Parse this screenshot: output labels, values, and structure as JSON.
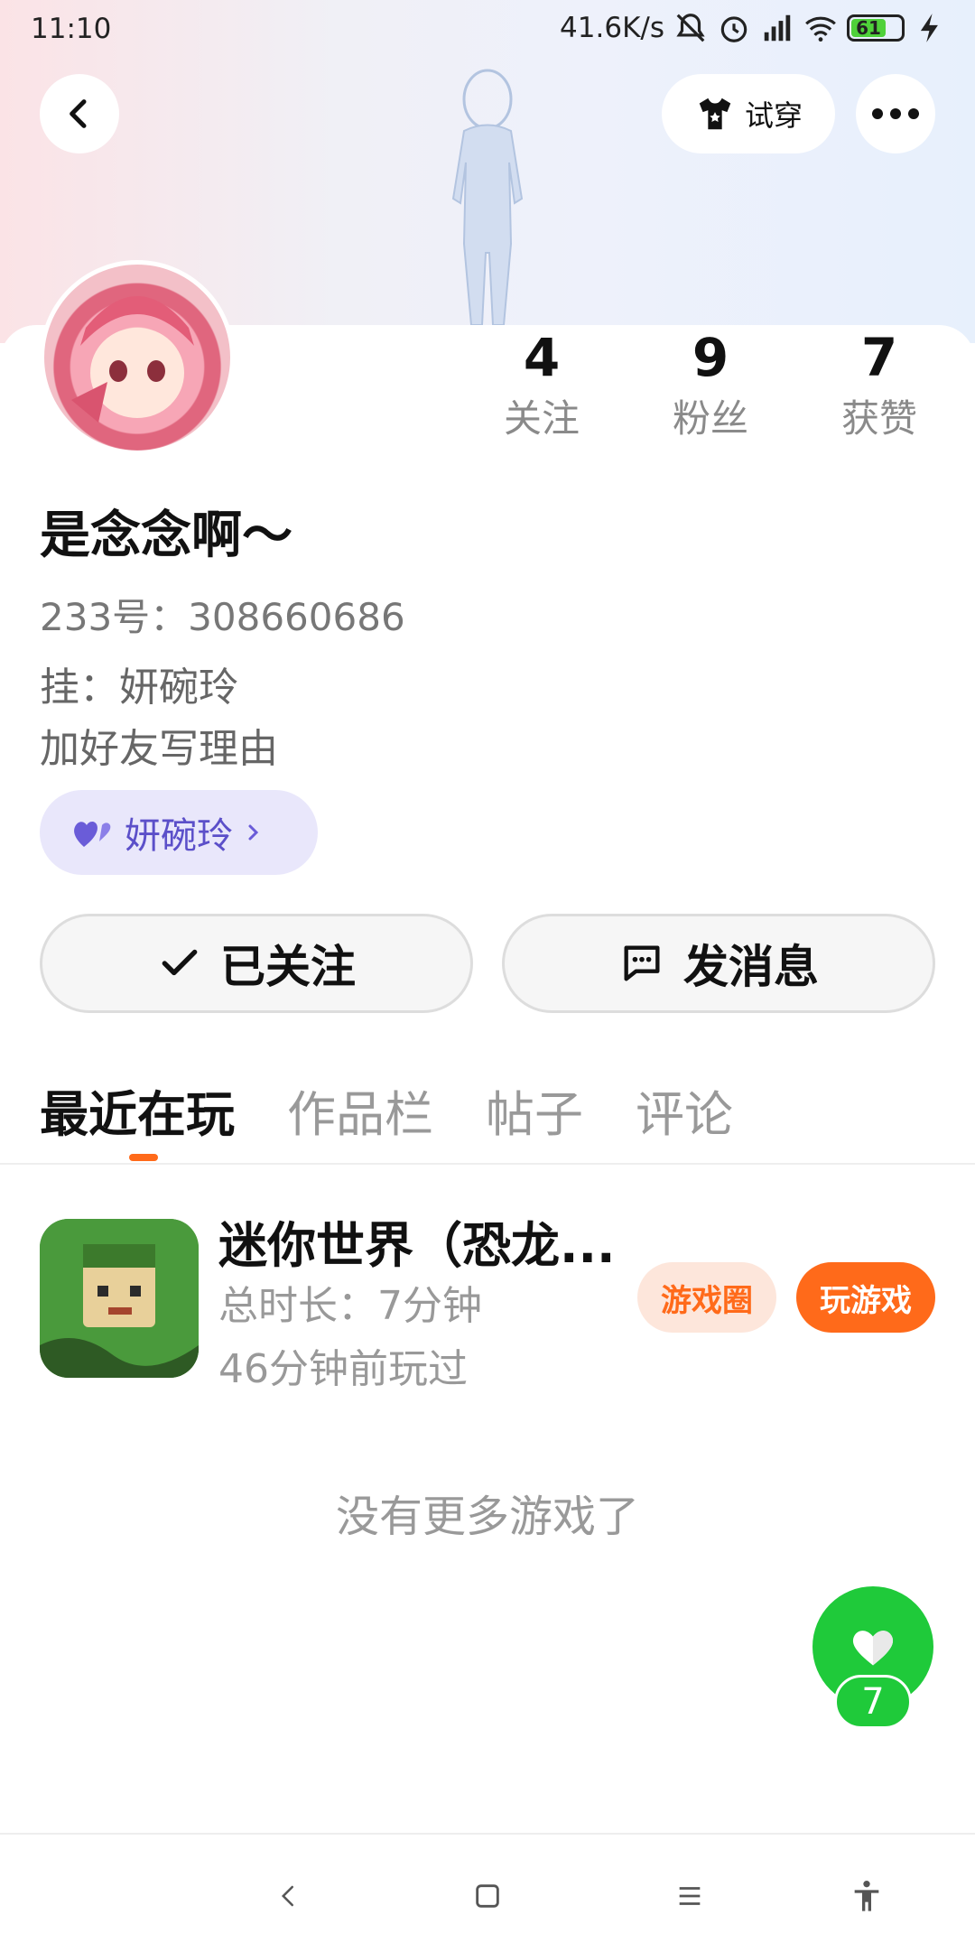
{
  "status_bar": {
    "time": "11:10",
    "speed": "41.6K/s",
    "battery": "61"
  },
  "header": {
    "try_on_label": "试穿"
  },
  "profile": {
    "stats": [
      {
        "value": "4",
        "label": "关注"
      },
      {
        "value": "9",
        "label": "粉丝"
      },
      {
        "value": "7",
        "label": "获赞"
      }
    ],
    "nickname": "是念念啊～",
    "uid": "233号：308660686",
    "bio_lines": [
      "挂：妍碗玲",
      "加好友写理由"
    ],
    "tag_label": "妍碗玲"
  },
  "actions": {
    "follow_label": "已关注",
    "message_label": "发消息"
  },
  "tabs": [
    "最近在玩",
    "作品栏",
    "帖子",
    "评论"
  ],
  "game": {
    "title": "迷你世界（恐龙...",
    "duration": "总时长：7分钟",
    "last_played": "46分钟前玩过",
    "circle_label": "游戏圈",
    "play_label": "玩游戏"
  },
  "list_footer": "没有更多游戏了",
  "like": {
    "count": "7"
  },
  "colors": {
    "accent": "#ff6a1a",
    "like_green": "#1fca3a",
    "tag_purple": "#5b4fc9"
  }
}
